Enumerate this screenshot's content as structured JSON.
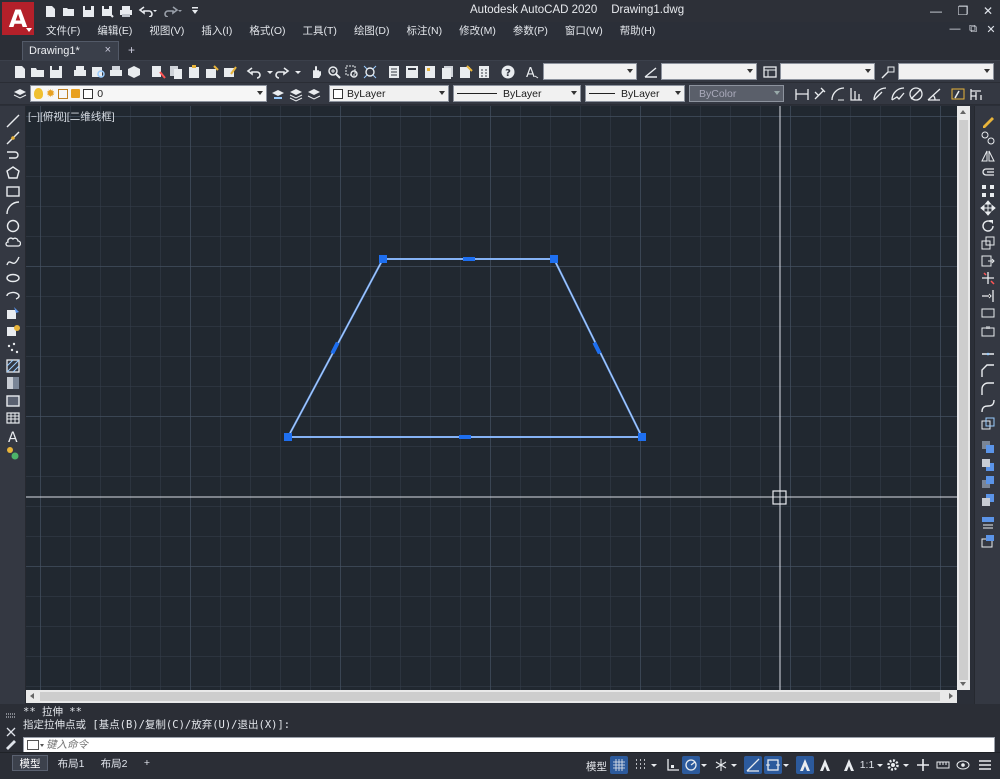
{
  "app": {
    "logo_letter": "A",
    "name": "Autodesk AutoCAD 2020",
    "file": "Drawing1.dwg"
  },
  "window_controls": {
    "minimize": "—",
    "restore": "❐",
    "close": "✕"
  },
  "menu": {
    "items": [
      "文件(F)",
      "编辑(E)",
      "视图(V)",
      "插入(I)",
      "格式(O)",
      "工具(T)",
      "绘图(D)",
      "标注(N)",
      "修改(M)",
      "参数(P)",
      "窗口(W)",
      "帮助(H)"
    ],
    "doc_controls": {
      "minimize": "—",
      "restore": "⧉",
      "close": "✕"
    }
  },
  "tabs": {
    "document_tab": "Drawing1*",
    "close_symbol": "×",
    "new_tab_symbol": "+"
  },
  "layer_toolbar": {
    "layer_name": "0",
    "color": "ByLayer",
    "linetype": "ByLayer",
    "lineweight": "ByLayer",
    "plotstyle": "ByColor"
  },
  "viewport": {
    "label": "[−][俯视][二维线框]"
  },
  "command_line": {
    "history": [
      "** 拉伸 **",
      "指定拉伸点或 [基点(B)/复制(C)/放弃(U)/退出(X)]:"
    ],
    "placeholder": "键入命令"
  },
  "layout_tabs": {
    "model": "模型",
    "layout1": "布局1",
    "layout2": "布局2",
    "add": "+"
  },
  "status": {
    "model_label": "模型",
    "scale": "1:1"
  },
  "colors": {
    "canvas": "#212830",
    "selection": "#5b94e8",
    "grip": "#1e6ff0",
    "crosshair": "#d9dde3",
    "logo": "#b4202a"
  },
  "icons": {
    "qat": [
      "new-icon",
      "open-icon",
      "save-icon",
      "save-as-icon",
      "print-icon",
      "undo-icon",
      "redo-icon",
      "customize-icon"
    ],
    "draw_palette": [
      "line-icon",
      "construction-line-icon",
      "polyline-icon",
      "polygon-icon",
      "rectangle-icon",
      "arc-icon",
      "circle-icon",
      "revision-cloud-icon",
      "spline-icon",
      "ellipse-icon",
      "ellipse-arc-icon",
      "insert-block-icon",
      "make-block-icon",
      "point-icon",
      "hatch-icon",
      "gradient-icon",
      "region-icon",
      "table-icon",
      "text-icon",
      "add-selected-icon"
    ],
    "modify_palette": [
      "erase-icon",
      "copy-icon",
      "mirror-icon",
      "offset-icon",
      "array-icon",
      "move-icon",
      "rotate-icon",
      "scale-icon",
      "stretch-icon",
      "trim-icon",
      "extend-icon",
      "break-at-point-icon",
      "break-icon",
      "join-icon",
      "chamfer-icon",
      "fillet-icon",
      "blend-icon",
      "explode-icon",
      "draworder-front-icon",
      "draworder-back-icon",
      "draworder-above-icon",
      "draworder-under-icon",
      "bring-text-front-icon",
      "bring-dims-front-icon"
    ]
  }
}
